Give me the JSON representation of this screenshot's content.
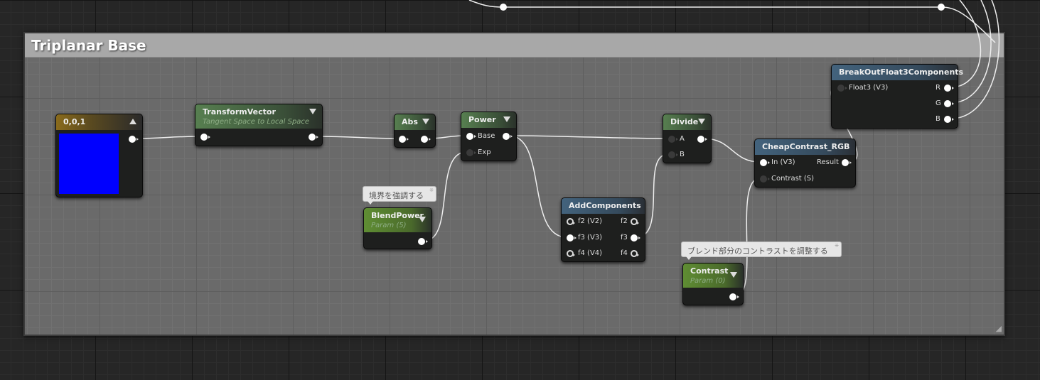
{
  "group": {
    "title": "Triplanar Base"
  },
  "nodes": {
    "constant": {
      "title": "0,0,1",
      "color": "#0000ff"
    },
    "transform": {
      "title": "TransformVector",
      "subtitle": "Tangent Space to Local Space"
    },
    "abs": {
      "title": "Abs"
    },
    "power": {
      "title": "Power",
      "inputs": [
        "Base",
        "Exp"
      ]
    },
    "blendpower": {
      "title": "BlendPower",
      "subtitle": "Param (5)",
      "comment": "境界を強調する"
    },
    "addcomponents": {
      "title": "AddComponents",
      "inputs": [
        "f2 (V2)",
        "f3 (V3)",
        "f4 (V4)"
      ],
      "outputs": [
        "f2",
        "f3",
        "f4"
      ]
    },
    "divide": {
      "title": "Divide",
      "inputs": [
        "A",
        "B"
      ]
    },
    "cheapcontrast": {
      "title": "CheapContrast_RGB",
      "inputs": [
        "In (V3)",
        "Contrast (S)"
      ],
      "outputs": [
        "Result"
      ]
    },
    "contrast": {
      "title": "Contrast",
      "subtitle": "Param (0)",
      "comment": "ブレンド部分のコントラストを調整する"
    },
    "breakout": {
      "title": "BreakOutFloat3Components",
      "inputs": [
        "Float3 (V3)"
      ],
      "outputs": [
        "R",
        "G",
        "B"
      ]
    }
  }
}
